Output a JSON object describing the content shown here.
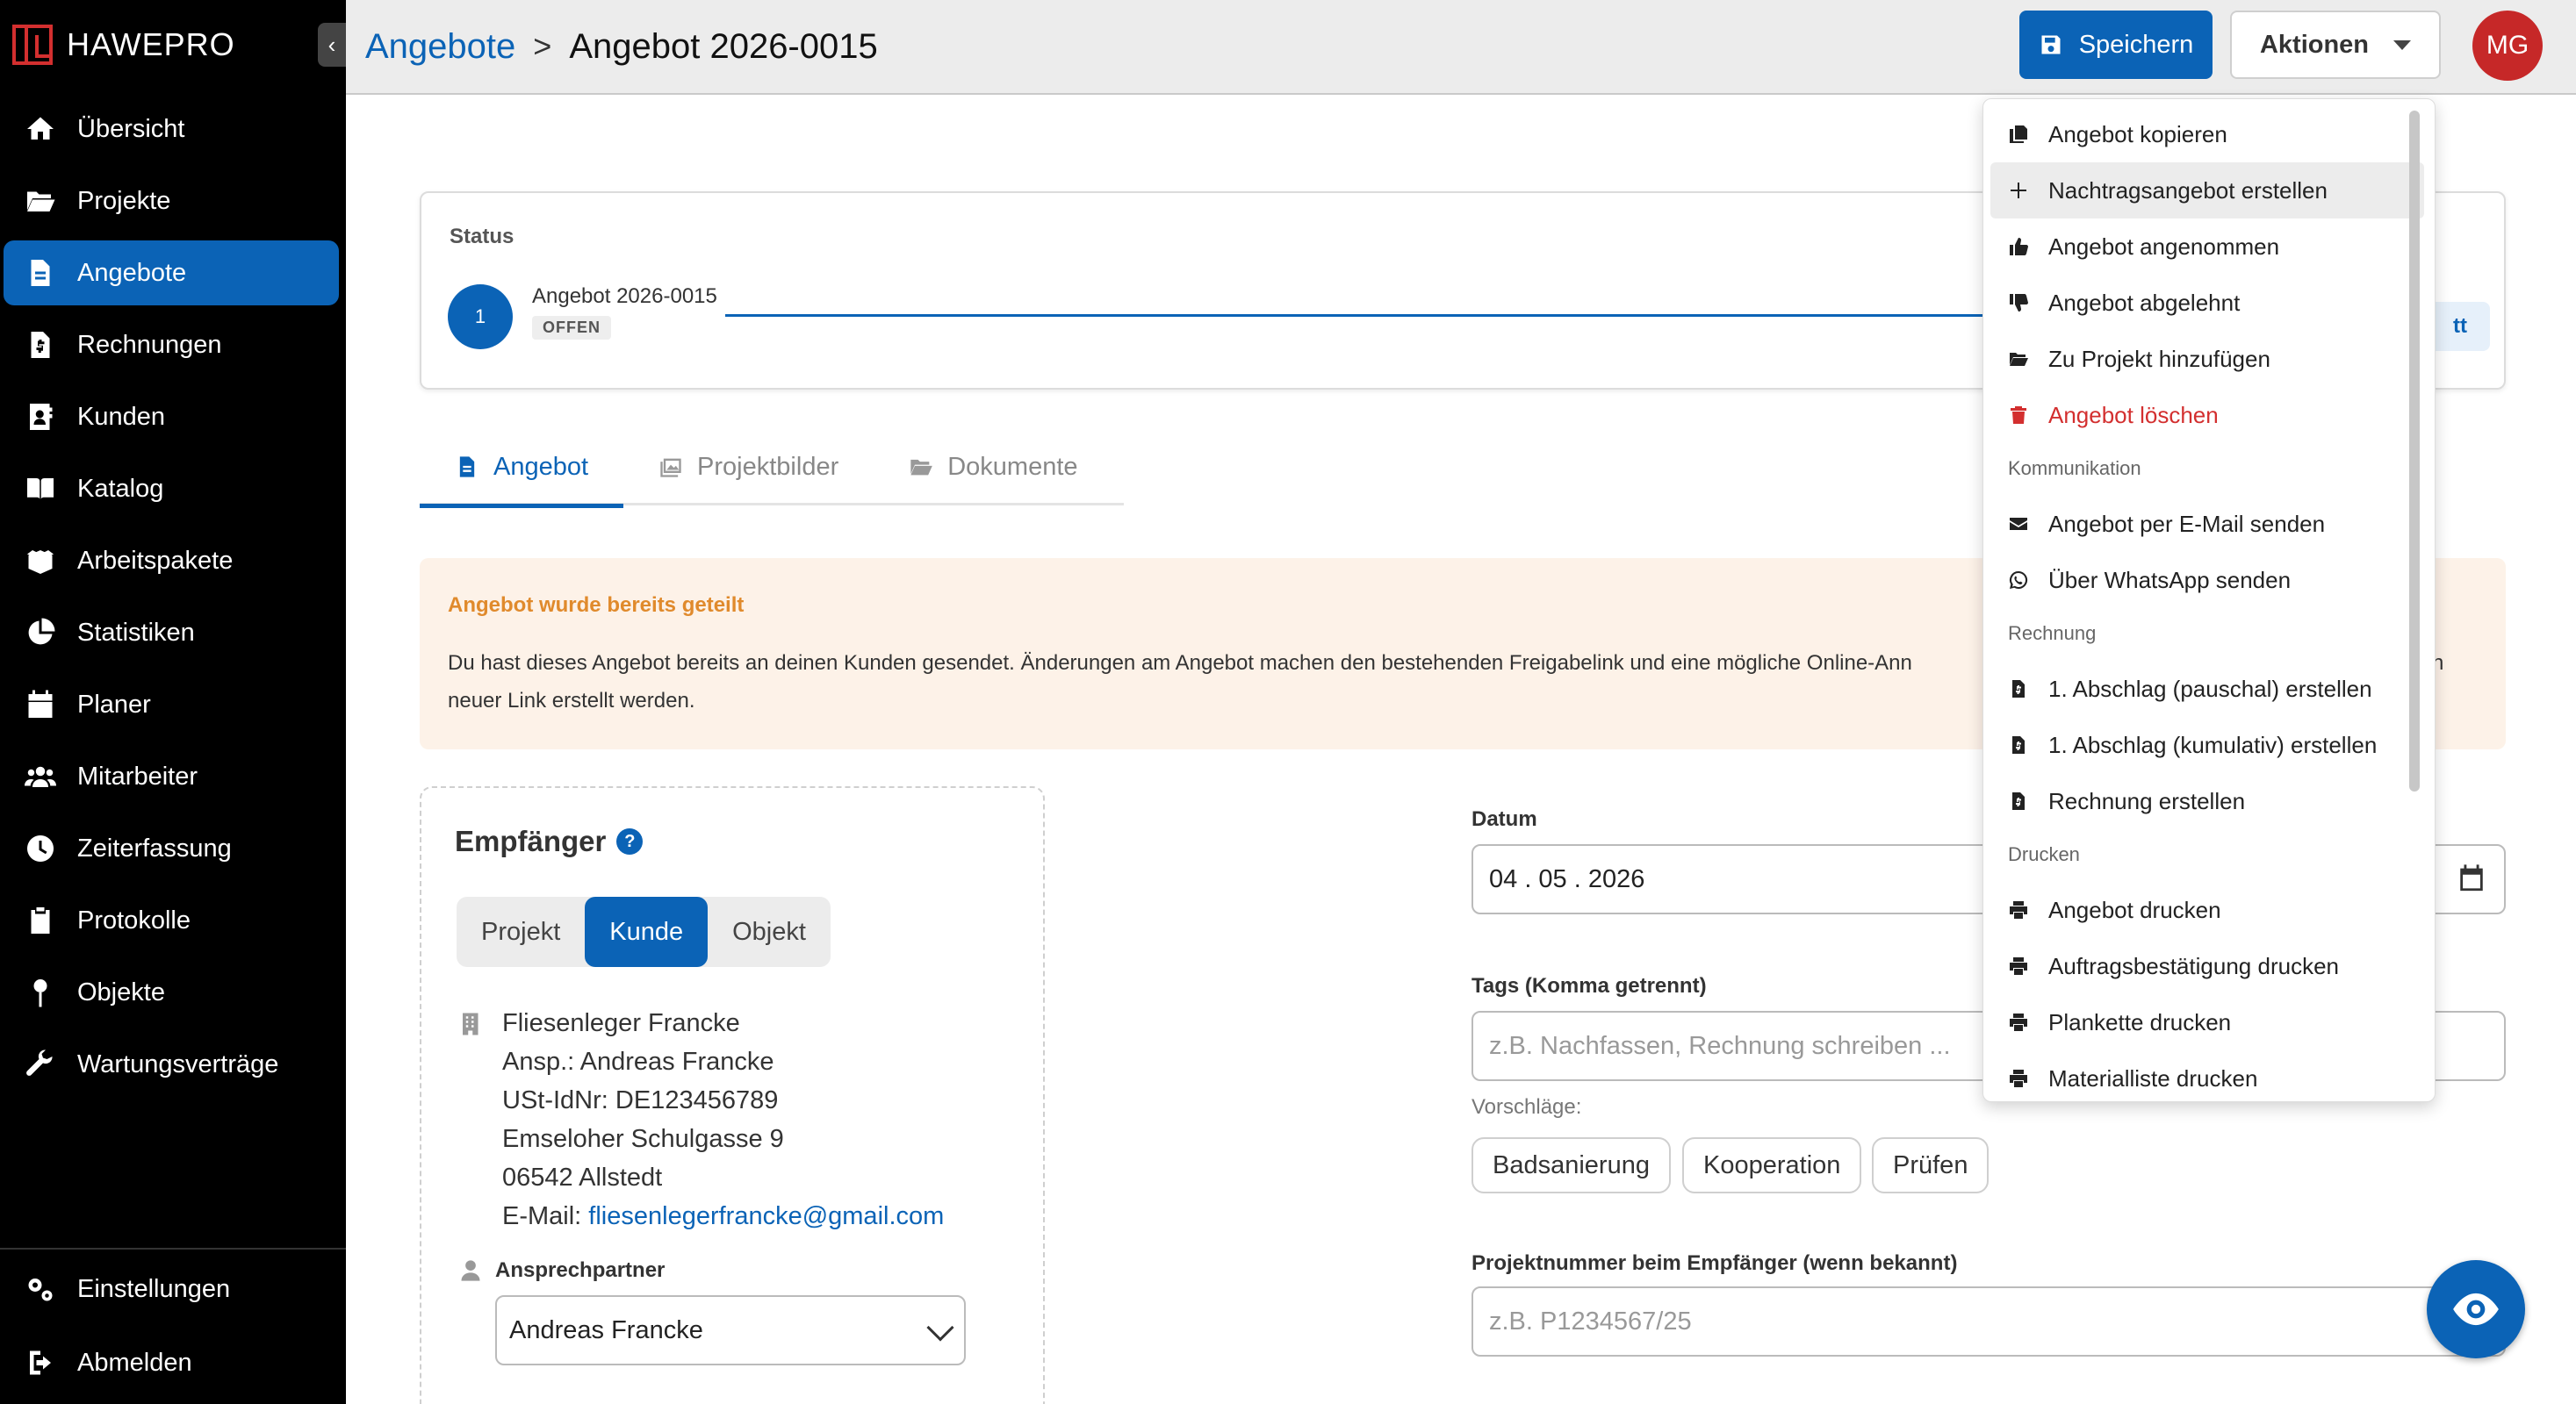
{
  "app": {
    "brand": "HAWEPRO",
    "collapse_glyph": "‹"
  },
  "sidebar": {
    "items": [
      {
        "label": "Übersicht",
        "icon": "home-icon"
      },
      {
        "label": "Projekte",
        "icon": "folder-open-icon"
      },
      {
        "label": "Angebote",
        "icon": "document-icon",
        "active": true
      },
      {
        "label": "Rechnungen",
        "icon": "invoice-icon"
      },
      {
        "label": "Kunden",
        "icon": "contact-card-icon"
      },
      {
        "label": "Katalog",
        "icon": "book-icon"
      },
      {
        "label": "Arbeitspakete",
        "icon": "package-icon"
      },
      {
        "label": "Statistiken",
        "icon": "pie-chart-icon"
      },
      {
        "label": "Planer",
        "icon": "calendar-icon"
      },
      {
        "label": "Mitarbeiter",
        "icon": "users-icon"
      },
      {
        "label": "Zeiterfassung",
        "icon": "clock-icon"
      },
      {
        "label": "Protokolle",
        "icon": "clipboard-icon"
      },
      {
        "label": "Objekte",
        "icon": "pin-icon"
      },
      {
        "label": "Wartungsverträge",
        "icon": "wrench-icon"
      }
    ],
    "bottom": [
      {
        "label": "Einstellungen",
        "icon": "gears-icon"
      },
      {
        "label": "Abmelden",
        "icon": "logout-icon"
      }
    ]
  },
  "header": {
    "breadcrumb_parent": "Angebote",
    "breadcrumb_sep": ">",
    "breadcrumb_current": "Angebot 2026-0015",
    "save_label": "Speichern",
    "actions_label": "Aktionen",
    "avatar_initials": "MG"
  },
  "status": {
    "title": "Status",
    "step_number": "1",
    "step_name": "Angebot 2026-0015",
    "step_badge": "OFFEN",
    "next_label": "tt"
  },
  "tabs": [
    {
      "label": "Angebot",
      "icon": "document-icon",
      "active": true
    },
    {
      "label": "Projektbilder",
      "icon": "images-icon"
    },
    {
      "label": "Dokumente",
      "icon": "folder-open-icon"
    }
  ],
  "alert": {
    "title": "Angebot wurde bereits geteilt",
    "text_line1": "Du hast dieses Angebot bereits an deinen Kunden gesendet. Änderungen am Angebot machen den bestehenden Freigabelink und eine mögliche Online-Ann",
    "text_line1_tail": "n",
    "text_line2": "neuer Link erstellt werden."
  },
  "recipient": {
    "title": "Empfänger",
    "help": "?",
    "segments": [
      "Projekt",
      "Kunde",
      "Objekt"
    ],
    "active_segment": "Kunde",
    "address": {
      "company": "Fliesenleger Francke",
      "contact": "Ansp.: Andreas Francke",
      "vat": "USt-IdNr: DE123456789",
      "street": "Emseloher Schulgasse 9",
      "city": "06542 Allstedt",
      "email_prefix": "E-Mail: ",
      "email": "fliesenlegerfrancke@gmail.com"
    },
    "contact_label": "Ansprechpartner",
    "contact_value": "Andreas Francke"
  },
  "form": {
    "date_label": "Datum",
    "date_value": "04 . 05 . 2026",
    "tags_label": "Tags (Komma getrennt)",
    "tags_placeholder": "z.B. Nachfassen, Rechnung schreiben ...",
    "suggestions_label": "Vorschläge:",
    "suggestions": [
      "Badsanierung",
      "Kooperation",
      "Prüfen"
    ],
    "project_number_label": "Projektnummer beim Empfänger (wenn bekannt)",
    "project_number_placeholder": "z.B. P1234567/25"
  },
  "menu": {
    "items": [
      {
        "label": "Angebot kopieren",
        "icon": "copy-icon"
      },
      {
        "label": "Nachtragsangebot erstellen",
        "icon": "plus-icon",
        "hover": true
      },
      {
        "label": "Angebot angenommen",
        "icon": "thumbs-up-icon"
      },
      {
        "label": "Angebot abgelehnt",
        "icon": "thumbs-down-icon"
      },
      {
        "label": "Zu Projekt hinzufügen",
        "icon": "folder-open-icon"
      },
      {
        "label": "Angebot löschen",
        "icon": "trash-icon",
        "danger": true
      }
    ],
    "section_communication": "Kommunikation",
    "communication": [
      {
        "label": "Angebot per E-Mail senden",
        "icon": "envelope-icon"
      },
      {
        "label": "Über WhatsApp senden",
        "icon": "whatsapp-icon"
      }
    ],
    "section_invoice": "Rechnung",
    "invoice": [
      {
        "label": "1. Abschlag (pauschal) erstellen",
        "icon": "invoice-icon"
      },
      {
        "label": "1. Abschlag (kumulativ) erstellen",
        "icon": "invoice-icon"
      },
      {
        "label": "Rechnung erstellen",
        "icon": "invoice-icon"
      }
    ],
    "section_print": "Drucken",
    "print": [
      {
        "label": "Angebot drucken",
        "icon": "printer-icon"
      },
      {
        "label": "Auftragsbestätigung drucken",
        "icon": "printer-icon"
      },
      {
        "label": "Plankette drucken",
        "icon": "printer-icon"
      },
      {
        "label": "Materialliste drucken",
        "icon": "printer-icon"
      }
    ]
  },
  "colors": {
    "primary": "#0b63b6",
    "danger": "#d32f2f",
    "alert_bg": "#fdf2e8",
    "alert_title": "#e08a2c",
    "avatar": "#c62828"
  }
}
